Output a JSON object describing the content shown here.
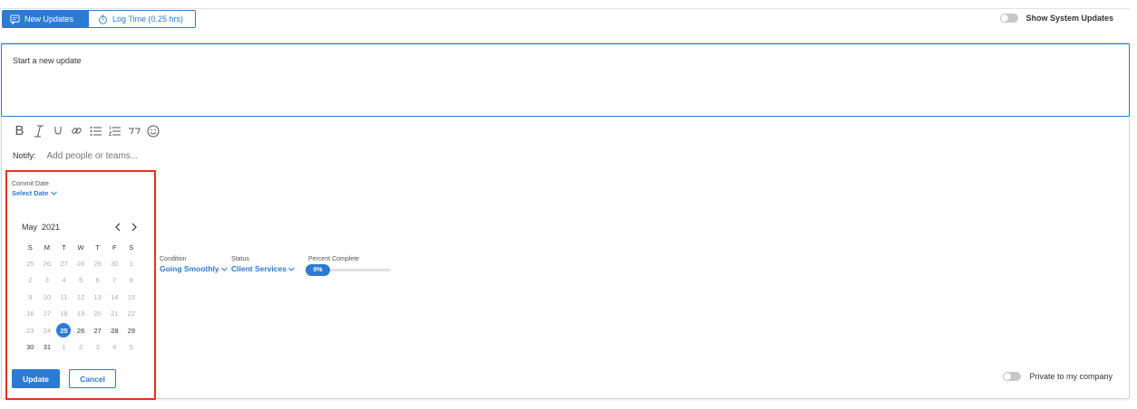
{
  "tabs": {
    "new_updates": "New Updates",
    "log_time": "Log Time (0.25 hrs)"
  },
  "system_updates": {
    "label": "Show System Updates",
    "enabled": false
  },
  "editor": {
    "placeholder": "Start a new update"
  },
  "toolbar": {
    "icons": [
      "bold-icon",
      "italic-icon",
      "underline-icon",
      "link-icon",
      "bulleted-list-icon",
      "numbered-list-icon",
      "quote-icon",
      "emoji-icon"
    ]
  },
  "notify": {
    "label": "Notify:",
    "placeholder": "Add people or teams..."
  },
  "commit_date": {
    "label": "Commit Date",
    "value": "Select Date"
  },
  "calendar": {
    "month": "May",
    "year": "2021",
    "weekdays": [
      "S",
      "M",
      "T",
      "W",
      "T",
      "F",
      "S"
    ],
    "selected_day": "25",
    "weeks": [
      [
        "25",
        "26",
        "27",
        "28",
        "29",
        "30",
        "1"
      ],
      [
        "2",
        "3",
        "4",
        "5",
        "6",
        "7",
        "8"
      ],
      [
        "9",
        "10",
        "11",
        "12",
        "13",
        "14",
        "15"
      ],
      [
        "16",
        "17",
        "18",
        "19",
        "20",
        "21",
        "22"
      ],
      [
        "23",
        "24",
        "25",
        "26",
        "27",
        "28",
        "29"
      ],
      [
        "30",
        "31",
        "1",
        "2",
        "3",
        "4",
        "5"
      ]
    ],
    "muted_rows": [
      [
        true,
        true,
        true,
        true,
        true,
        true,
        true
      ],
      [
        true,
        true,
        true,
        true,
        true,
        true,
        true
      ],
      [
        true,
        true,
        true,
        true,
        true,
        true,
        true
      ],
      [
        true,
        true,
        true,
        true,
        true,
        true,
        true
      ],
      [
        true,
        true,
        false,
        false,
        false,
        false,
        false
      ],
      [
        false,
        false,
        true,
        true,
        true,
        true,
        true
      ]
    ]
  },
  "actions": {
    "update": "Update",
    "cancel": "Cancel"
  },
  "condition": {
    "label": "Condition",
    "value": "Going Smoothly"
  },
  "status": {
    "label": "Status",
    "value": "Client Services"
  },
  "percent_complete": {
    "label": "Percent Complete",
    "value_text": "0%",
    "value": 0
  },
  "private": {
    "label": "Private to my company",
    "enabled": false
  },
  "colors": {
    "accent": "#2b7bd3",
    "highlight": "#e0351f"
  }
}
